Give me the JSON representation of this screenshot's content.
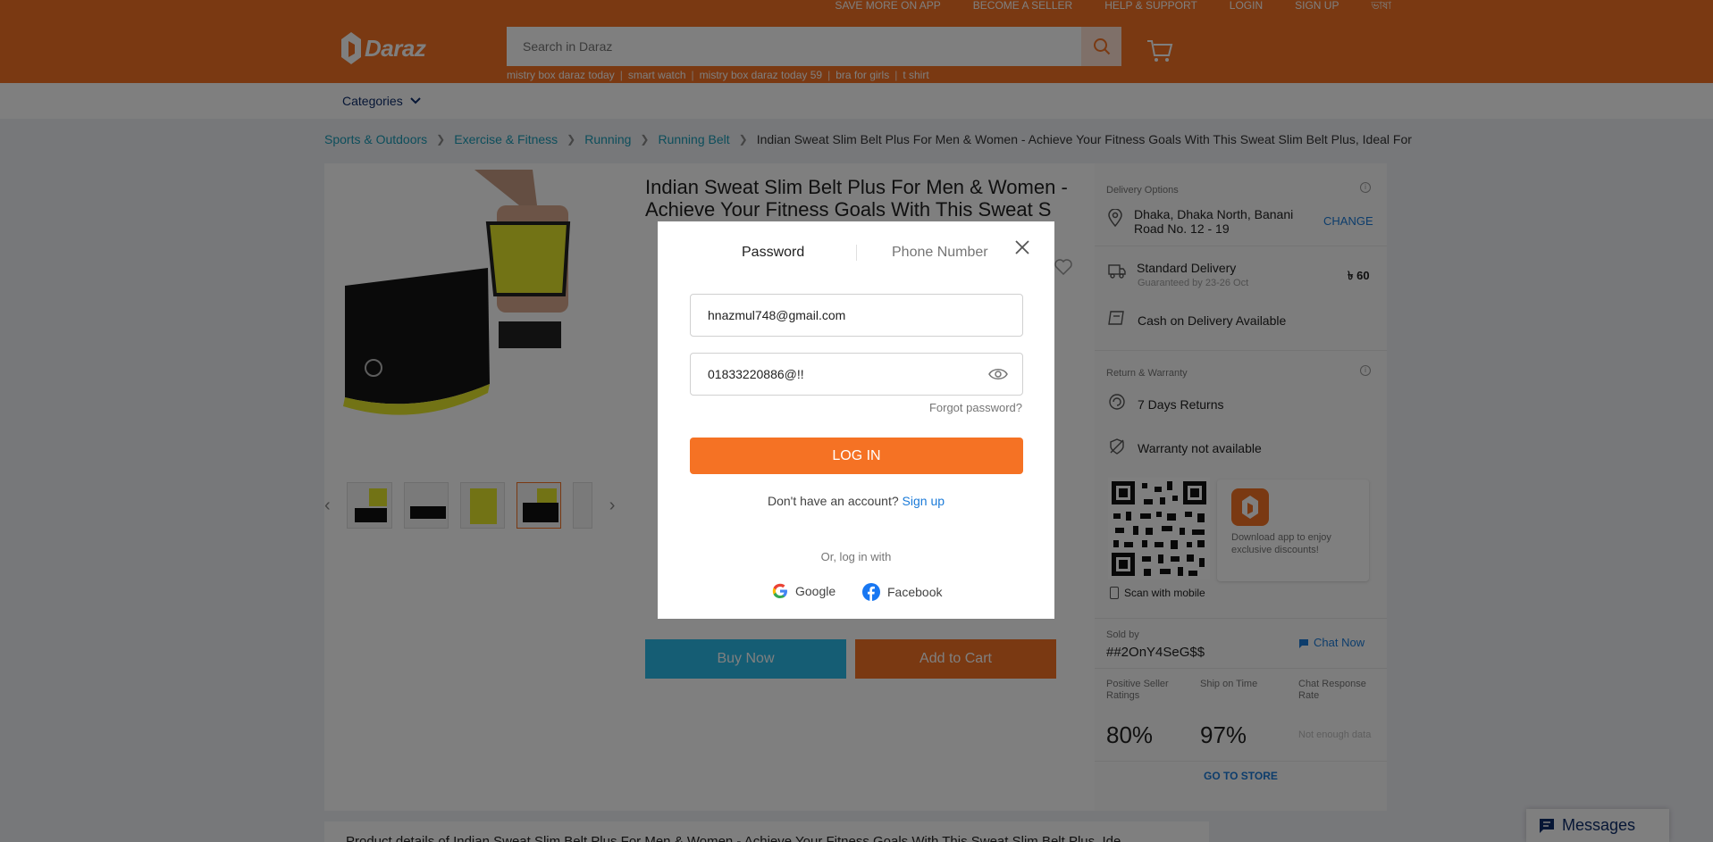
{
  "header": {
    "top_links": [
      "SAVE MORE ON APP",
      "BECOME A SELLER",
      "HELP & SUPPORT",
      "LOGIN",
      "SIGN UP",
      "ভাষা"
    ],
    "logo_text": "Daraz",
    "search_placeholder": "Search in Daraz",
    "suggestions": [
      "mistry box daraz today",
      "smart watch",
      "mistry box daraz today 59",
      "bra for girls",
      "t shirt"
    ]
  },
  "nav": {
    "categories_label": "Categories"
  },
  "breadcrumb": {
    "items": [
      "Sports & Outdoors",
      "Exercise & Fitness",
      "Running",
      "Running Belt"
    ],
    "current": "Indian Sweat Slim Belt Plus For Men & Women - Achieve Your Fitness Goals With This Sweat Slim Belt Plus, Ideal For"
  },
  "product": {
    "title": "Indian Sweat Slim Belt Plus For Men & Women - Achieve Your Fitness Goals With This Sweat S",
    "buy_now": "Buy Now",
    "add_to_cart": "Add to Cart"
  },
  "side": {
    "delivery_options_label": "Delivery Options",
    "address": "Dhaka, Dhaka North, Banani Road No. 12 - 19",
    "change": "CHANGE",
    "standard_delivery": "Standard Delivery",
    "guaranteed": "Guaranteed by 23-26 Oct",
    "delivery_price": "৳ 60",
    "cod": "Cash on Delivery Available",
    "return_label": "Return & Warranty",
    "returns": "7 Days Returns",
    "warranty": "Warranty not available",
    "app_text": "Download app to enjoy exclusive discounts!",
    "scan": "Scan with mobile",
    "sold_by": "Sold by",
    "seller": "##2OnY4SeG$$",
    "chat_now": "Chat Now",
    "ratings_label": "Positive Seller Ratings",
    "ship_label": "Ship on Time",
    "chat_rate_label": "Chat Response Rate",
    "ratings_value": "80%",
    "ship_value": "97%",
    "chat_rate_value": "Not enough data",
    "go_to_store": "GO TO STORE"
  },
  "details_heading": "Product details of Indian Sweat Slim Belt Plus For Men & Women - Achieve Your Fitness Goals With This Sweat Slim Belt Plus, Ide",
  "messages_label": "Messages",
  "login_modal": {
    "tab_password": "Password",
    "tab_phone": "Phone Number",
    "email_value": "hnazmul748@gmail.com",
    "password_value": "01833220886@!!",
    "forgot": "Forgot password?",
    "login_button": "LOG IN",
    "no_account": "Don't have an account?",
    "sign_up": "Sign up",
    "or_login_with": "Or, log in with",
    "google": "Google",
    "facebook": "Facebook"
  },
  "colors": {
    "brand_orange": "#f57224",
    "buy_blue": "#2abbe8",
    "link_teal": "#1a9cb7"
  }
}
